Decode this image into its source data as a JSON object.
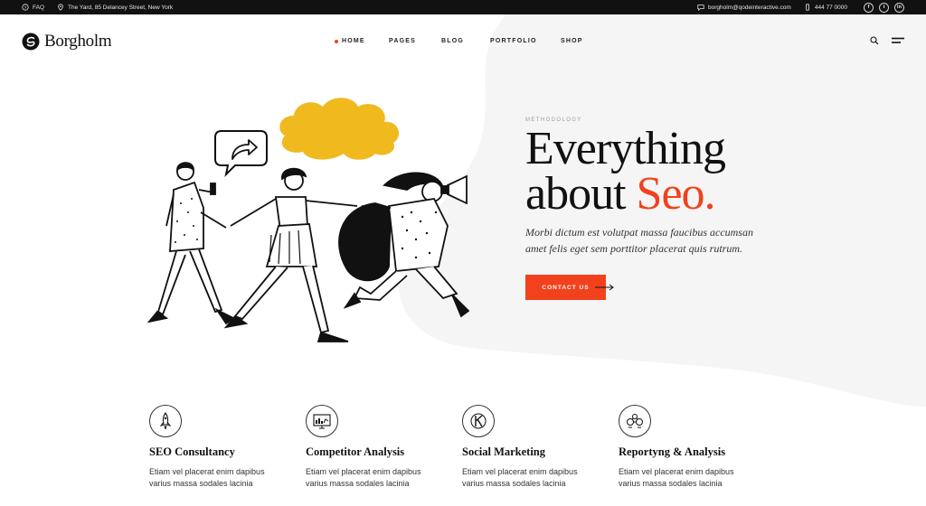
{
  "topbar": {
    "faq": "FAQ",
    "address": "The Yard, 85 Delancey Street, New York",
    "email": "borgholm@qodeinteractive.com",
    "phone": "444 77 0000",
    "social": [
      "f",
      "t",
      "in"
    ]
  },
  "header": {
    "logo": "Borgholm",
    "nav": [
      "Home",
      "Pages",
      "Blog",
      "Portfolio",
      "Shop"
    ],
    "active_nav": "Home"
  },
  "hero": {
    "eyebrow": "Methodology",
    "headline_line1": "Everything",
    "headline_about": "about",
    "headline_accent": "Seo.",
    "subtext": "Morbi dictum est volutpat massa faucibus accumsan amet felis eget sem porttitor placerat quis rutrum.",
    "cta": "Contact Us"
  },
  "services": [
    {
      "title": "SEO Consultancy",
      "text": "Etiam vel placerat enim dapibus varius massa sodales lacinia",
      "icon": "rocket-icon"
    },
    {
      "title": "Competitor Analysis",
      "text": "Etiam vel placerat enim dapibus varius massa sodales lacinia",
      "icon": "monitor-chart-icon"
    },
    {
      "title": "Social Marketing",
      "text": "Etiam vel placerat enim dapibus varius massa sodales lacinia",
      "icon": "letter-k-icon"
    },
    {
      "title": "Reportyng & Analysis",
      "text": "Etiam vel placerat enim dapibus varius massa sodales lacinia",
      "icon": "people-network-icon"
    }
  ],
  "colors": {
    "accent": "#f2411d",
    "cloud": "#f0b91e",
    "topbar": "#111111",
    "blob": "#f5f5f5"
  }
}
